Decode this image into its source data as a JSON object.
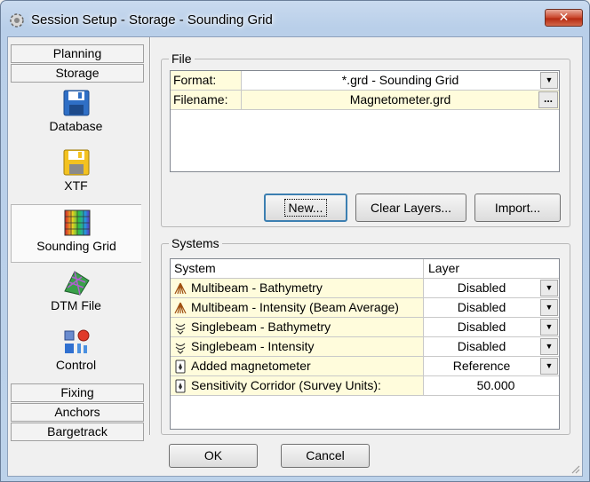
{
  "window": {
    "title": "Session Setup - Storage -  Sounding Grid",
    "close_label": "✕"
  },
  "nav": {
    "top_bars": [
      {
        "label": "Planning"
      },
      {
        "label": "Storage"
      }
    ],
    "items": [
      {
        "label": "Database",
        "icon": "floppy-disk-icon"
      },
      {
        "label": "XTF",
        "icon": "yellow-floppy-icon"
      },
      {
        "label": "Sounding Grid",
        "icon": "color-grid-icon",
        "selected": true
      },
      {
        "label": "DTM File",
        "icon": "dtm-mesh-icon"
      },
      {
        "label": "Control",
        "icon": "control-icon"
      }
    ],
    "bottom_bars": [
      {
        "label": "Fixing"
      },
      {
        "label": "Anchors"
      },
      {
        "label": "Bargetrack"
      }
    ]
  },
  "file_group": {
    "title": "File",
    "format_label": "Format:",
    "format_value": "*.grd - Sounding Grid",
    "filename_label": "Filename:",
    "filename_value": "Magnetometer.grd",
    "dots_label": "...",
    "new_label": "New...",
    "clear_label": "Clear Layers...",
    "import_label": "Import..."
  },
  "systems_group": {
    "title": "Systems",
    "col_system": "System",
    "col_layer": "Layer",
    "rows": [
      {
        "name": "Multibeam - Bathymetry",
        "layer": "Disabled",
        "icon": "multibeam-icon",
        "dropdown": true
      },
      {
        "name": "Multibeam - Intensity (Beam Average)",
        "layer": "Disabled",
        "icon": "multibeam-icon",
        "dropdown": true
      },
      {
        "name": "Singlebeam - Bathymetry",
        "layer": "Disabled",
        "icon": "singlebeam-icon",
        "dropdown": true
      },
      {
        "name": "Singlebeam - Intensity",
        "layer": "Disabled",
        "icon": "singlebeam-icon",
        "dropdown": true
      },
      {
        "name": "Added magnetometer",
        "layer": "Reference",
        "icon": "magnetometer-icon",
        "dropdown": true
      },
      {
        "name": "Sensitivity Corridor (Survey Units):",
        "layer": "50.000",
        "icon": "magnetometer-icon",
        "dropdown": false
      }
    ]
  },
  "footer": {
    "ok_label": "OK",
    "cancel_label": "Cancel"
  },
  "colors": {
    "property_label_bg": "#fffcdc",
    "title_gradient": "#c9daef",
    "close_red": "#c9452b"
  }
}
